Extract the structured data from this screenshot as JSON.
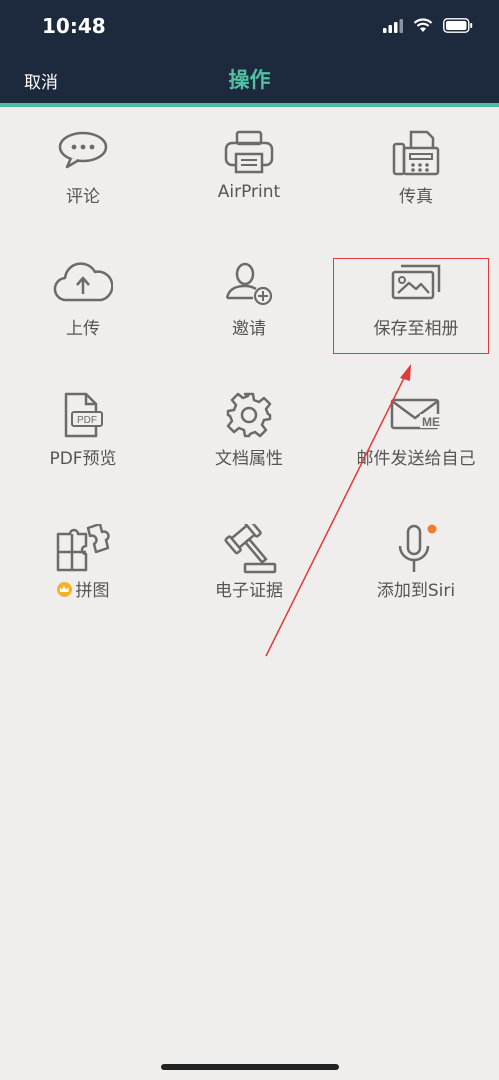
{
  "status_bar": {
    "time": "10:48"
  },
  "header": {
    "cancel_label": "取消",
    "title": "操作"
  },
  "actions": [
    {
      "label": "评论",
      "icon": "comment-icon"
    },
    {
      "label": "AirPrint",
      "icon": "printer-icon"
    },
    {
      "label": "传真",
      "icon": "fax-icon"
    },
    {
      "label": "上传",
      "icon": "cloud-upload-icon"
    },
    {
      "label": "邀请",
      "icon": "invite-user-icon"
    },
    {
      "label": "保存至相册",
      "icon": "photo-album-icon"
    },
    {
      "label": "PDF预览",
      "icon": "pdf-file-icon"
    },
    {
      "label": "文档属性",
      "icon": "gear-icon"
    },
    {
      "label": "邮件发送给自己",
      "icon": "mail-me-icon"
    },
    {
      "label": "拼图",
      "icon": "puzzle-icon",
      "badge": "crown-icon"
    },
    {
      "label": "电子证据",
      "icon": "gavel-icon"
    },
    {
      "label": "添加到Siri",
      "icon": "microphone-icon",
      "badge": "notification-dot"
    }
  ],
  "colors": {
    "header_bg": "#1d2a3d",
    "accent": "#4fc2a4",
    "background": "#efeeec",
    "annotation": "#e03a3a",
    "siri_dot": "#f07d2e",
    "crown": "#f3b42b"
  }
}
